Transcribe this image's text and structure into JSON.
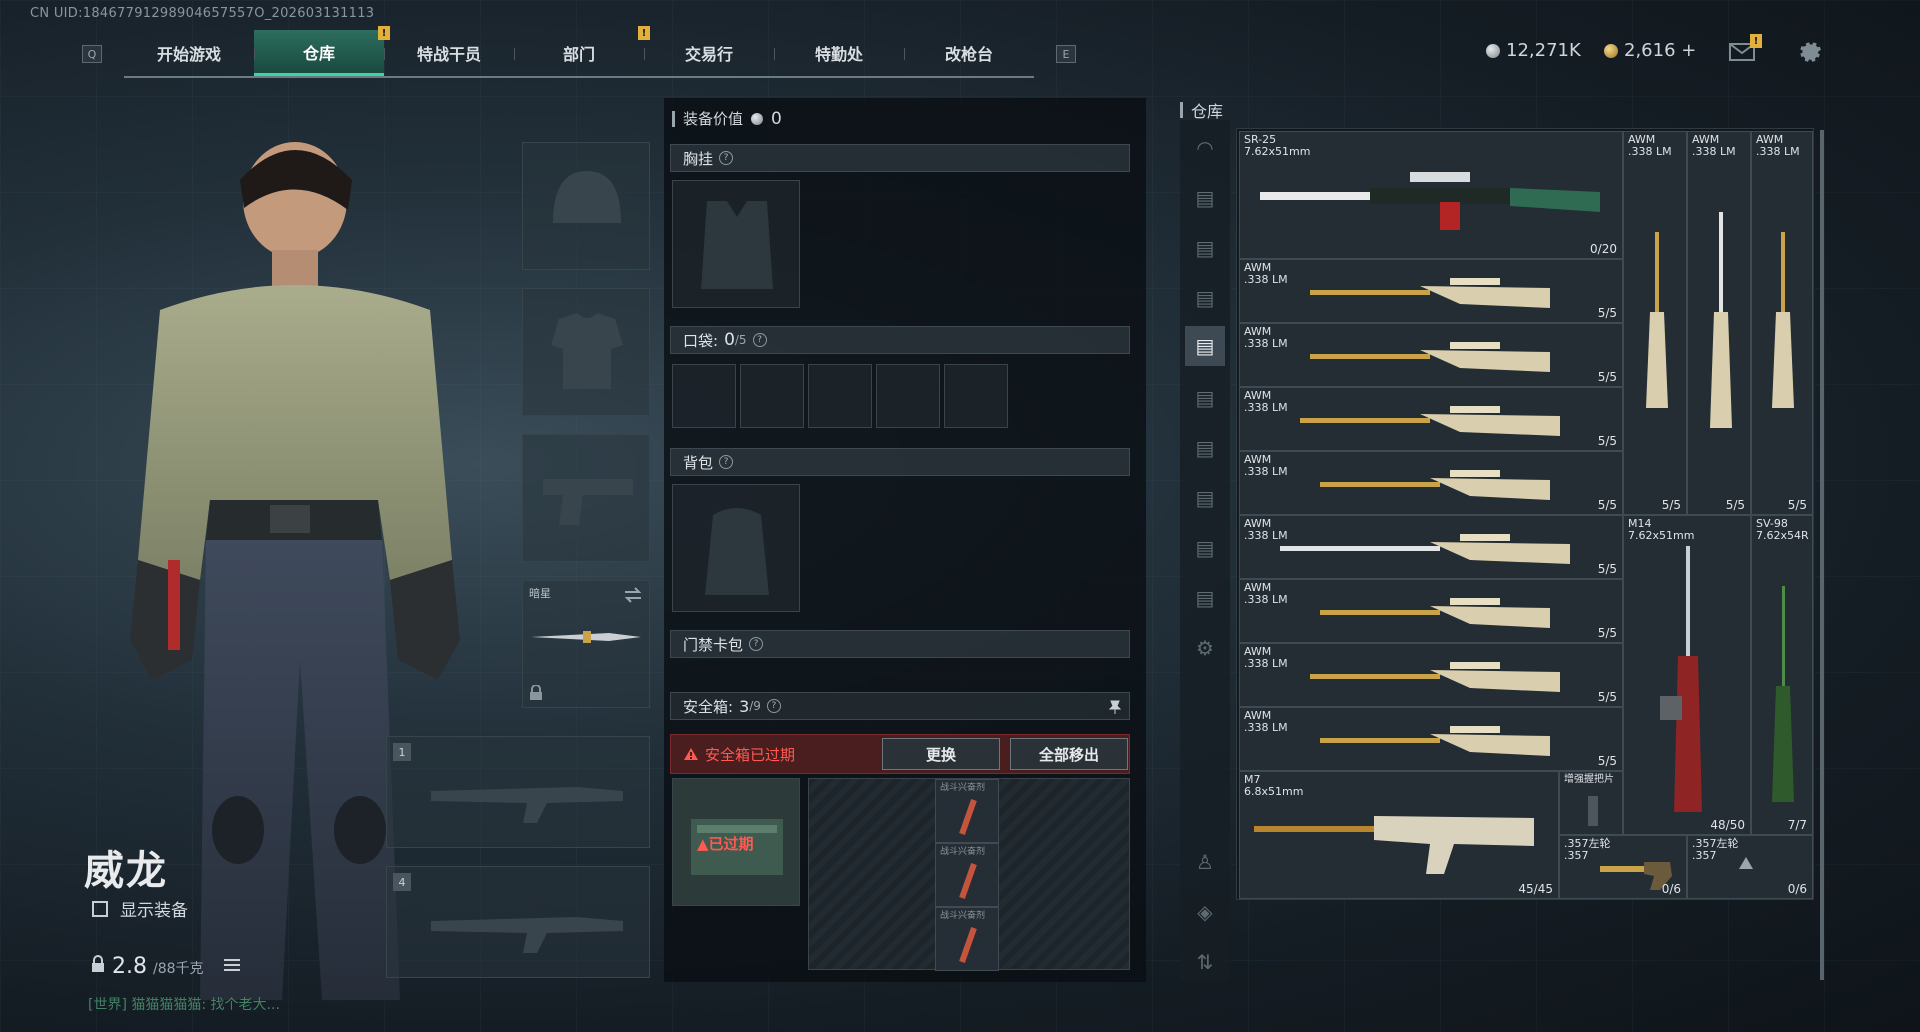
{
  "uid_text": "CN UID:18467791298904657557O_202603131113",
  "nav": {
    "left_key": "Q",
    "right_key": "E",
    "tabs": [
      {
        "label": "开始游戏",
        "active": false,
        "notif": ""
      },
      {
        "label": "仓库",
        "active": true,
        "notif": ""
      },
      {
        "label": "特战干员",
        "active": false,
        "notif": "!"
      },
      {
        "label": "部门",
        "active": false,
        "notif": ""
      },
      {
        "label": "交易行",
        "active": false,
        "notif": "!"
      },
      {
        "label": "特勤处",
        "active": false,
        "notif": ""
      },
      {
        "label": "改枪台",
        "active": false,
        "notif": ""
      }
    ]
  },
  "currency": {
    "silver": "12,271K",
    "gold": "2,616 +",
    "mail_notif": "!"
  },
  "character": {
    "name": "威龙",
    "show_equipment": "显示装备",
    "weight": "2.8",
    "weight_max": "/88千克",
    "chat": "[世界] 猫猫猫猫猫: 找个老大..."
  },
  "equip_slots": {
    "melee_label": "暗星",
    "weapon1_num": "1",
    "weapon2_num": "4"
  },
  "middle": {
    "value_label": "装备价值",
    "value": "0",
    "chest_label": "胸挂",
    "pocket_label": "口袋:",
    "pocket_count": "0",
    "pocket_max": "/5",
    "backpack_label": "背包",
    "keycard_label": "门禁卡包",
    "safebox_label": "安全箱:",
    "safebox_count": "3",
    "safebox_max": "/9",
    "warning": "安全箱已过期",
    "replace_btn": "更换",
    "remove_all_btn": "全部移出",
    "expired_badge": "已过期",
    "safebox_item_label": "战斗兴奋剂"
  },
  "stash": {
    "title": "仓库",
    "items": [
      {
        "name": "SR-25",
        "caliber": "7.62x51mm",
        "count": "0/20"
      },
      {
        "name": "AWM",
        "caliber": ".338 LM",
        "count": "5/5"
      },
      {
        "name": "AWM",
        "caliber": ".338 LM",
        "count": "5/5"
      },
      {
        "name": "AWM",
        "caliber": ".338 LM",
        "count": "5/5"
      },
      {
        "name": "AWM",
        "caliber": ".338 LM",
        "count": "5/5"
      },
      {
        "name": "AWM",
        "caliber": ".338 LM",
        "count": "5/5"
      },
      {
        "name": "AWM",
        "caliber": ".338 LM",
        "count": "5/5"
      },
      {
        "name": "AWM",
        "caliber": ".338 LM",
        "count": "5/5"
      },
      {
        "name": "AWM",
        "caliber": ".338 LM",
        "count": "5/5"
      },
      {
        "name": "M7",
        "caliber": "6.8x51mm",
        "count": "45/45"
      },
      {
        "name": "AWM",
        "caliber": ".338 LM",
        "count": "5/5"
      },
      {
        "name": "AWM",
        "caliber": ".338 LM",
        "count": "5/5"
      },
      {
        "name": "AWM",
        "caliber": ".338 LM",
        "count": "5/5"
      },
      {
        "name": "M14",
        "caliber": "7.62x51mm",
        "count": "48/50"
      },
      {
        "name": "SV-98",
        "caliber": "7.62x54R",
        "count": "7/7"
      },
      {
        "name": "增强握把片",
        "caliber": "",
        "count": ""
      },
      {
        "name": ".357左轮",
        "caliber": ".357",
        "count": "0/6"
      },
      {
        "name": ".357左轮",
        "caliber": ".357",
        "count": "0/6"
      }
    ]
  },
  "colors": {
    "accent": "#38d6a8",
    "warning": "#ff5a52",
    "gold": "#c9a24a"
  }
}
